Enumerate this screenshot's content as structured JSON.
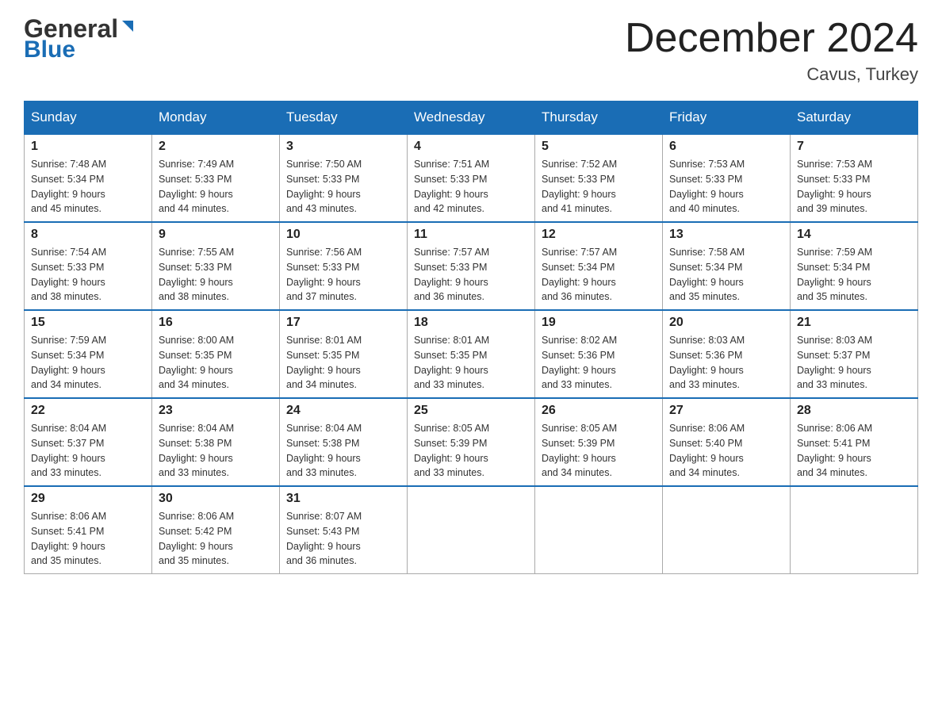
{
  "header": {
    "logo_general": "General",
    "logo_blue": "Blue",
    "month_title": "December 2024",
    "location": "Cavus, Turkey"
  },
  "days_of_week": [
    "Sunday",
    "Monday",
    "Tuesday",
    "Wednesday",
    "Thursday",
    "Friday",
    "Saturday"
  ],
  "weeks": [
    [
      {
        "day": "1",
        "sunrise": "7:48 AM",
        "sunset": "5:34 PM",
        "daylight": "9 hours and 45 minutes."
      },
      {
        "day": "2",
        "sunrise": "7:49 AM",
        "sunset": "5:33 PM",
        "daylight": "9 hours and 44 minutes."
      },
      {
        "day": "3",
        "sunrise": "7:50 AM",
        "sunset": "5:33 PM",
        "daylight": "9 hours and 43 minutes."
      },
      {
        "day": "4",
        "sunrise": "7:51 AM",
        "sunset": "5:33 PM",
        "daylight": "9 hours and 42 minutes."
      },
      {
        "day": "5",
        "sunrise": "7:52 AM",
        "sunset": "5:33 PM",
        "daylight": "9 hours and 41 minutes."
      },
      {
        "day": "6",
        "sunrise": "7:53 AM",
        "sunset": "5:33 PM",
        "daylight": "9 hours and 40 minutes."
      },
      {
        "day": "7",
        "sunrise": "7:53 AM",
        "sunset": "5:33 PM",
        "daylight": "9 hours and 39 minutes."
      }
    ],
    [
      {
        "day": "8",
        "sunrise": "7:54 AM",
        "sunset": "5:33 PM",
        "daylight": "9 hours and 38 minutes."
      },
      {
        "day": "9",
        "sunrise": "7:55 AM",
        "sunset": "5:33 PM",
        "daylight": "9 hours and 38 minutes."
      },
      {
        "day": "10",
        "sunrise": "7:56 AM",
        "sunset": "5:33 PM",
        "daylight": "9 hours and 37 minutes."
      },
      {
        "day": "11",
        "sunrise": "7:57 AM",
        "sunset": "5:33 PM",
        "daylight": "9 hours and 36 minutes."
      },
      {
        "day": "12",
        "sunrise": "7:57 AM",
        "sunset": "5:34 PM",
        "daylight": "9 hours and 36 minutes."
      },
      {
        "day": "13",
        "sunrise": "7:58 AM",
        "sunset": "5:34 PM",
        "daylight": "9 hours and 35 minutes."
      },
      {
        "day": "14",
        "sunrise": "7:59 AM",
        "sunset": "5:34 PM",
        "daylight": "9 hours and 35 minutes."
      }
    ],
    [
      {
        "day": "15",
        "sunrise": "7:59 AM",
        "sunset": "5:34 PM",
        "daylight": "9 hours and 34 minutes."
      },
      {
        "day": "16",
        "sunrise": "8:00 AM",
        "sunset": "5:35 PM",
        "daylight": "9 hours and 34 minutes."
      },
      {
        "day": "17",
        "sunrise": "8:01 AM",
        "sunset": "5:35 PM",
        "daylight": "9 hours and 34 minutes."
      },
      {
        "day": "18",
        "sunrise": "8:01 AM",
        "sunset": "5:35 PM",
        "daylight": "9 hours and 33 minutes."
      },
      {
        "day": "19",
        "sunrise": "8:02 AM",
        "sunset": "5:36 PM",
        "daylight": "9 hours and 33 minutes."
      },
      {
        "day": "20",
        "sunrise": "8:03 AM",
        "sunset": "5:36 PM",
        "daylight": "9 hours and 33 minutes."
      },
      {
        "day": "21",
        "sunrise": "8:03 AM",
        "sunset": "5:37 PM",
        "daylight": "9 hours and 33 minutes."
      }
    ],
    [
      {
        "day": "22",
        "sunrise": "8:04 AM",
        "sunset": "5:37 PM",
        "daylight": "9 hours and 33 minutes."
      },
      {
        "day": "23",
        "sunrise": "8:04 AM",
        "sunset": "5:38 PM",
        "daylight": "9 hours and 33 minutes."
      },
      {
        "day": "24",
        "sunrise": "8:04 AM",
        "sunset": "5:38 PM",
        "daylight": "9 hours and 33 minutes."
      },
      {
        "day": "25",
        "sunrise": "8:05 AM",
        "sunset": "5:39 PM",
        "daylight": "9 hours and 33 minutes."
      },
      {
        "day": "26",
        "sunrise": "8:05 AM",
        "sunset": "5:39 PM",
        "daylight": "9 hours and 34 minutes."
      },
      {
        "day": "27",
        "sunrise": "8:06 AM",
        "sunset": "5:40 PM",
        "daylight": "9 hours and 34 minutes."
      },
      {
        "day": "28",
        "sunrise": "8:06 AM",
        "sunset": "5:41 PM",
        "daylight": "9 hours and 34 minutes."
      }
    ],
    [
      {
        "day": "29",
        "sunrise": "8:06 AM",
        "sunset": "5:41 PM",
        "daylight": "9 hours and 35 minutes."
      },
      {
        "day": "30",
        "sunrise": "8:06 AM",
        "sunset": "5:42 PM",
        "daylight": "9 hours and 35 minutes."
      },
      {
        "day": "31",
        "sunrise": "8:07 AM",
        "sunset": "5:43 PM",
        "daylight": "9 hours and 36 minutes."
      },
      null,
      null,
      null,
      null
    ]
  ],
  "labels": {
    "sunrise": "Sunrise:",
    "sunset": "Sunset:",
    "daylight": "Daylight:"
  }
}
